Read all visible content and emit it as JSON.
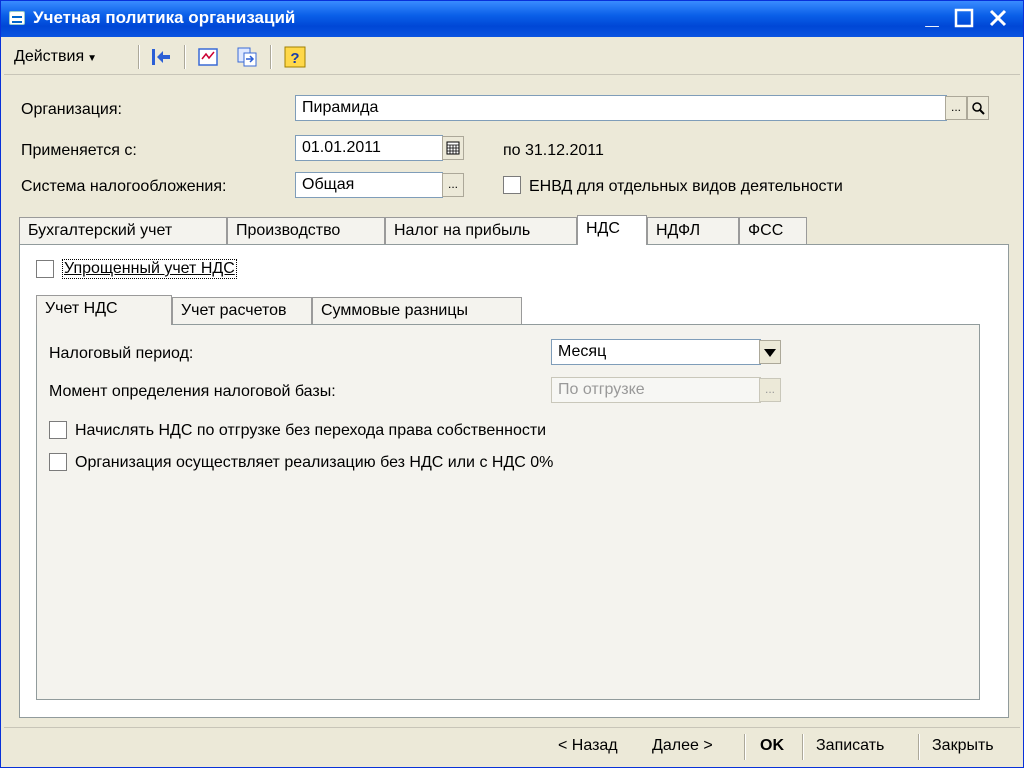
{
  "window": {
    "title": "Учетная политика организаций"
  },
  "toolbar": {
    "actions_label": "Действия"
  },
  "form": {
    "org_label": "Организация:",
    "org_value": "Пирамида",
    "applies_label": "Применяется с:",
    "applies_value": "01.01.2011",
    "period_to": "по 31.12.2011",
    "tax_system_label": "Система налогообложения:",
    "tax_system_value": "Общая",
    "envd_label": "ЕНВД для отдельных видов деятельности"
  },
  "tabs": [
    {
      "label": "Бухгалтерский учет"
    },
    {
      "label": "Производство"
    },
    {
      "label": "Налог на прибыль"
    },
    {
      "label": "НДС"
    },
    {
      "label": "НДФЛ"
    },
    {
      "label": "ФСС"
    }
  ],
  "nds": {
    "simplified_label": "Упрощенный учет НДС",
    "subtabs": [
      {
        "label": "Учет НДС"
      },
      {
        "label": "Учет расчетов"
      },
      {
        "label": "Суммовые разницы"
      }
    ],
    "tax_period_label": "Налоговый период:",
    "tax_period_value": "Месяц",
    "moment_label": "Момент определения налоговой базы:",
    "moment_value": "По отгрузке",
    "accrue_label": "Начислять НДС по отгрузке без перехода права собственности",
    "zero_label": "Организация осуществляет реализацию без НДС или с НДС 0%"
  },
  "footer": {
    "back_label": "< Назад",
    "next_label": "Далее >",
    "ok_label": "OK",
    "save_label": "Записать",
    "close_label": "Закрыть"
  }
}
